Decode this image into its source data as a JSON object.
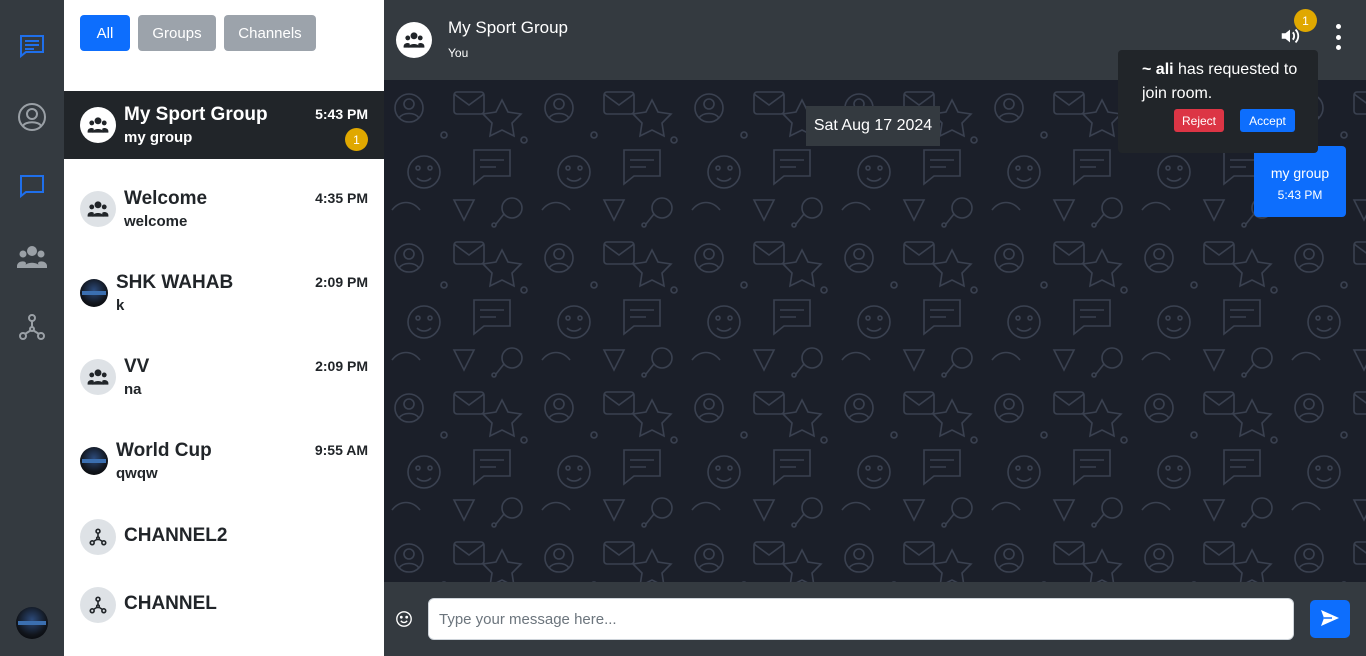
{
  "colors": {
    "accent": "#0d6efd",
    "rail_active": "#1f6feb",
    "rail_inactive": "#9aa0a6",
    "badge": "#e0a800",
    "danger": "#dc3545",
    "dark": "#212529",
    "panel": "#343a40"
  },
  "rail": {
    "items": [
      {
        "icon": "chat-lines-icon",
        "active": true
      },
      {
        "icon": "user-circle-icon",
        "active": false
      },
      {
        "icon": "chat-bubble-icon",
        "active": true
      },
      {
        "icon": "people-group-icon",
        "active": false
      },
      {
        "icon": "channel-hub-icon",
        "active": false
      }
    ],
    "profile_icon": "avatar"
  },
  "filters": {
    "all": "All",
    "groups": "Groups",
    "channels": "Channels",
    "selected": "All"
  },
  "chats": [
    {
      "name": "My Sport Group",
      "last": "my group",
      "time": "5:43 PM",
      "badge": "1",
      "icon": "group-icon",
      "active": true
    },
    {
      "name": "Welcome",
      "last": "welcome",
      "time": "4:35 PM",
      "icon": "group-icon"
    },
    {
      "name": "SHK WAHAB",
      "last": "k",
      "time": "2:09 PM",
      "icon": "photo-avatar"
    },
    {
      "name": "VV",
      "last": "na",
      "time": "2:09 PM",
      "icon": "group-icon"
    },
    {
      "name": "World Cup",
      "last": "qwqw",
      "time": "9:55 AM",
      "icon": "photo-avatar"
    },
    {
      "name": "CHANNEL2",
      "icon": "channel-icon"
    },
    {
      "name": "CHANNEL",
      "icon": "channel-icon"
    }
  ],
  "header": {
    "title": "My Sport Group",
    "subtitle": "You",
    "notification_count": "1"
  },
  "conversation": {
    "date": "Sat Aug 17 2024",
    "messages": [
      {
        "text": "my group",
        "time": "5:43 PM",
        "outgoing": true
      }
    ]
  },
  "join_request": {
    "user": "~ ali",
    "text": " has requested to join room.",
    "reject": "Reject",
    "accept": "Accept"
  },
  "composer": {
    "placeholder": "Type your message here...",
    "value": ""
  }
}
